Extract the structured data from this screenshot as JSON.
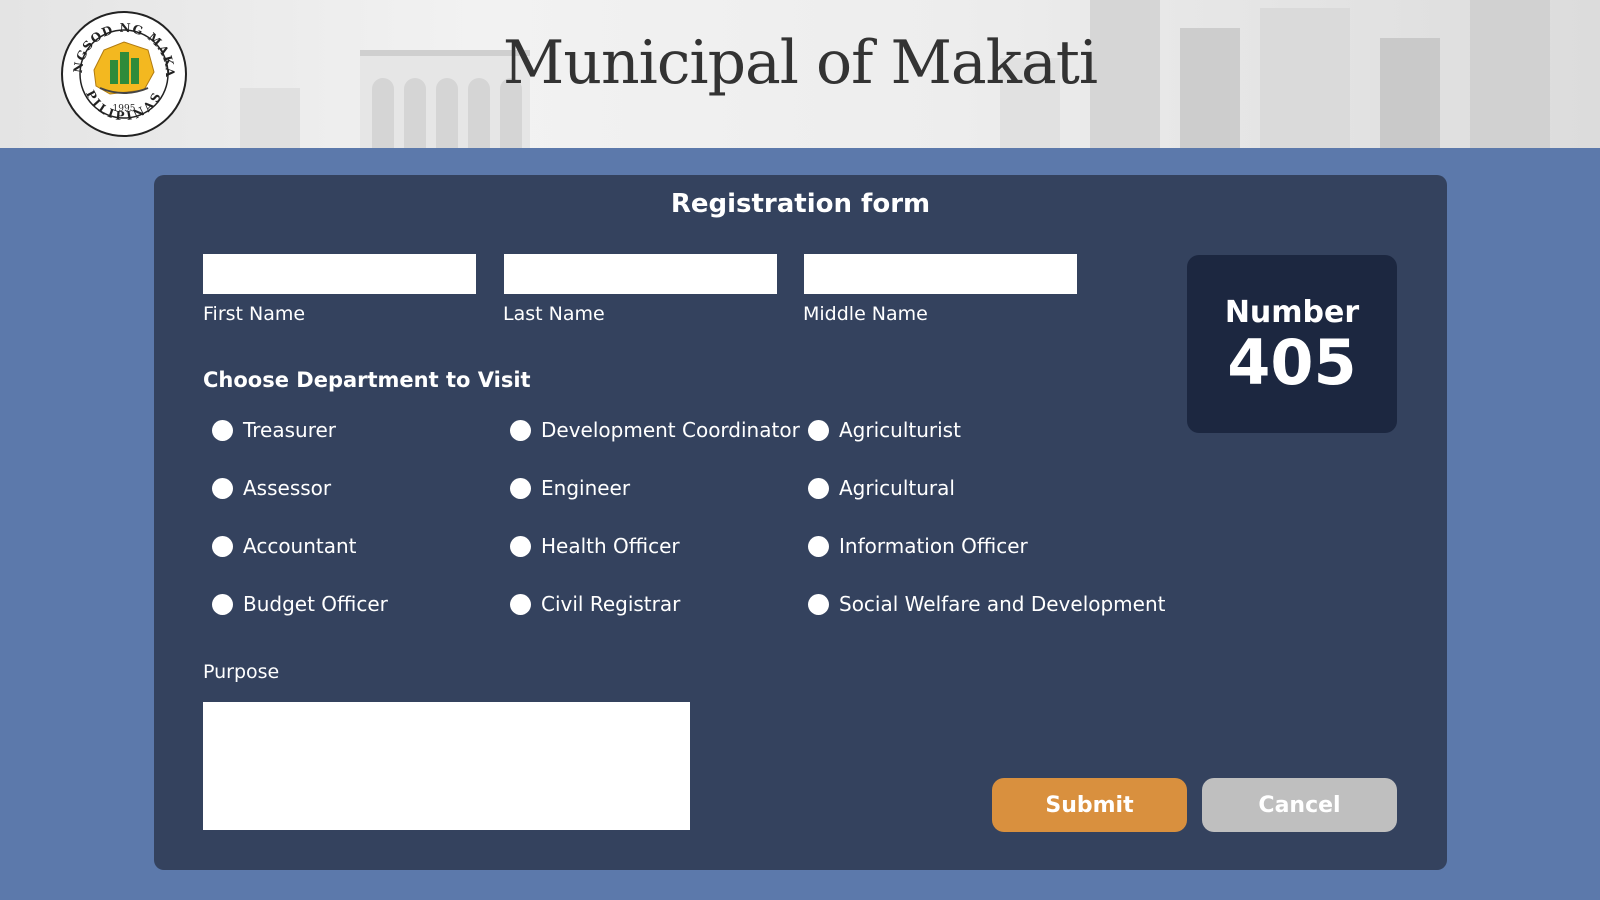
{
  "header": {
    "title": "Municipal of Makati",
    "seal": {
      "top_text": "LUNGSOD NG MAKATI",
      "bottom_text": "PILIPINAS",
      "year": "1995"
    }
  },
  "form": {
    "title": "Registration form",
    "fields": [
      {
        "label": "First Name",
        "value": ""
      },
      {
        "label": "Last Name",
        "value": ""
      },
      {
        "label": "Middle Name",
        "value": ""
      }
    ],
    "department_heading": "Choose Department to Visit",
    "departments": [
      "Treasurer",
      "Assessor",
      "Accountant",
      "Budget Officer",
      "Development Coordinator",
      "Engineer",
      "Health Officer",
      "Civil Registrar",
      "Agriculturist",
      "Agricultural",
      "Information Officer",
      "Social Welfare and Development"
    ],
    "purpose_label": "Purpose",
    "purpose_value": "",
    "submit_label": "Submit",
    "cancel_label": "Cancel"
  },
  "queue": {
    "label": "Number",
    "value": "405"
  },
  "colors": {
    "page_bg": "#5c79ab",
    "panel_bg": "#34425e",
    "number_bg": "#1c2740",
    "submit": "#d9903e",
    "cancel": "#bfbfbf"
  }
}
